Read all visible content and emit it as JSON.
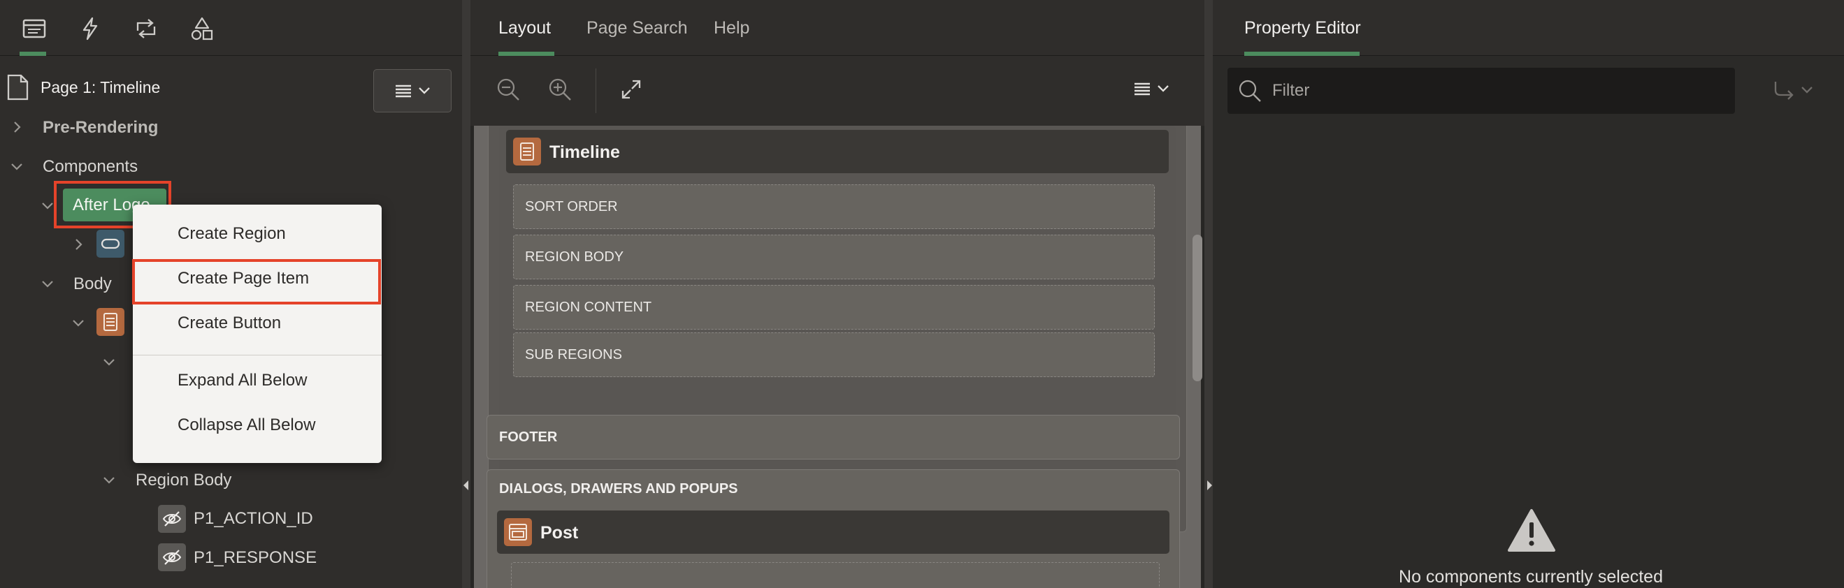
{
  "left": {
    "tab_icons": [
      "rendering-tab-icon",
      "dynamic-actions-tab-icon",
      "processing-tab-icon",
      "shared-components-tab-icon"
    ],
    "page_title": "Page 1: Timeline",
    "tree": {
      "pre_rendering": "Pre-Rendering",
      "components": "Components",
      "after_logo": "After Logo",
      "body": "Body",
      "region_body": "Region Body",
      "item1": "P1_ACTION_ID",
      "item2": "P1_RESPONSE"
    },
    "context_menu": {
      "create_region": "Create Region",
      "create_page_item": "Create Page Item",
      "create_button": "Create Button",
      "expand_all": "Expand All Below",
      "collapse_all": "Collapse All Below"
    }
  },
  "middle": {
    "tabs": [
      "Layout",
      "Page Search",
      "Help"
    ],
    "active_tab": "Layout",
    "regions": {
      "timeline_title": "Timeline",
      "slots": [
        "SORT ORDER",
        "REGION BODY",
        "REGION CONTENT",
        "SUB REGIONS"
      ],
      "footer": "FOOTER",
      "dialogs": "DIALOGS, DRAWERS AND POPUPS",
      "post_title": "Post"
    }
  },
  "right": {
    "tab": "Property Editor",
    "filter_placeholder": "Filter",
    "empty_message": "No components currently selected"
  },
  "colors": {
    "accent_green": "#4c8c5e",
    "highlight_red": "#e5432a",
    "region_icon_orange": "#b4693f"
  }
}
